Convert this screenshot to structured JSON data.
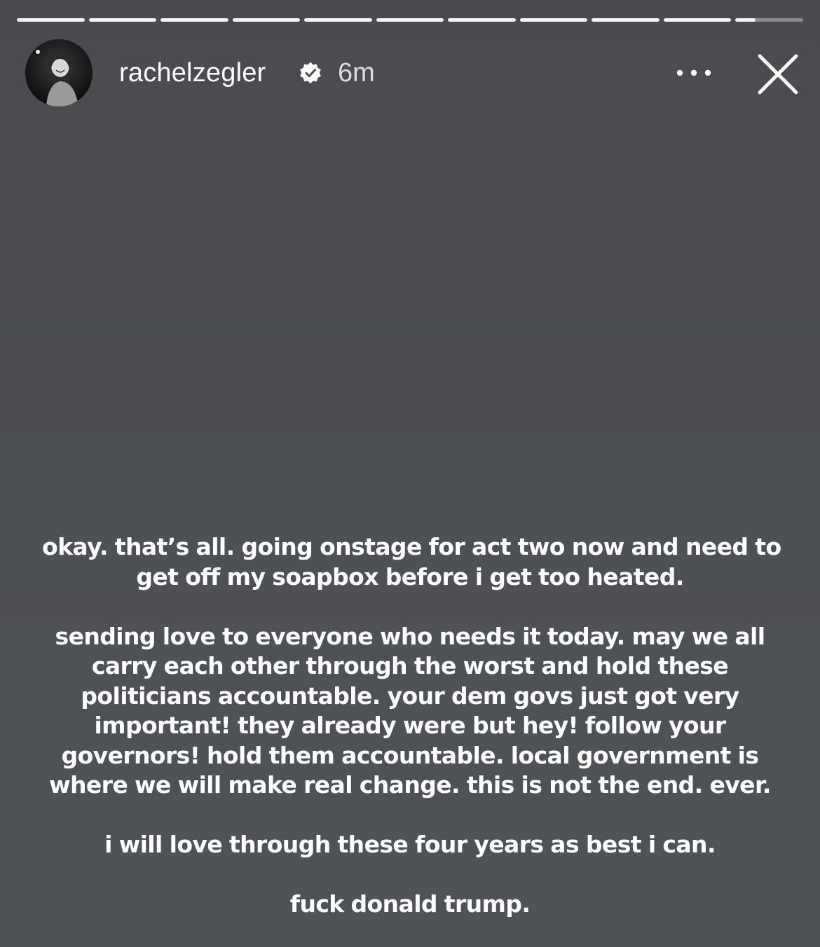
{
  "story": {
    "segments_total": 11,
    "segments_completed": 10,
    "current_segment_progress": 0.3
  },
  "header": {
    "username": "rachelzegler",
    "verified": true,
    "timestamp": "6m"
  },
  "icons": {
    "verified": "verified-badge-icon",
    "more": "more-options-icon",
    "close": "close-icon"
  },
  "caption": {
    "lines": [
      "okay. that’s all. going onstage for act two now and need to",
      "get off my soapbox before i get too heated.",
      "",
      "sending love to everyone who needs it today. may we all",
      "carry each other through the worst and hold these",
      "politicians accountable. your dem govs just got very",
      "important! they already were but hey! follow your",
      "governors! hold them accountable. local government is",
      "where we will make real change. this is not the end. ever.",
      "",
      "i will love through these four years as best i can.",
      "",
      "fuck donald trump."
    ]
  }
}
